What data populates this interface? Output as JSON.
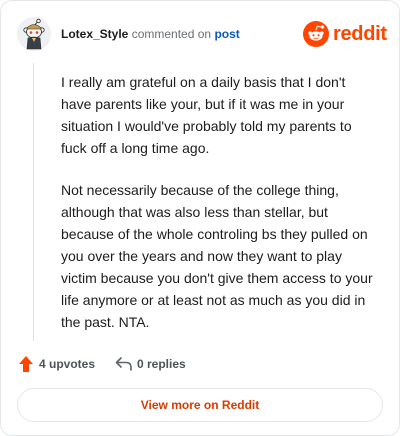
{
  "header": {
    "username": "Lotex_Style",
    "commented_text": "commented on",
    "post_link": "post",
    "avatar_icon": "snoo-avatar",
    "logo_icon": "reddit-snoo-icon",
    "logo_text": "reddit"
  },
  "comment": {
    "paragraphs": [
      "I really am grateful on a daily basis that I don't have parents like your, but if it was me in your situation I would've probably told my parents to fuck off a long time ago.",
      "Not necessarily because of the college thing, although that was also less than stellar, but because of the whole controling bs they pulled on you over the years and now they want to play victim because you don't give them access to your life anymore or at least not as much as you did in the past. NTA."
    ]
  },
  "actions": {
    "upvotes_label": "4 upvotes",
    "upvote_icon": "upvote-arrow-icon",
    "replies_label": "0 replies",
    "reply_icon": "reply-arrow-icon"
  },
  "footer": {
    "view_more_label": "View more on Reddit"
  },
  "colors": {
    "brand": "#ff4500",
    "link": "#0a5ab8",
    "button_text": "#d93a00",
    "muted": "#6a6f74"
  }
}
